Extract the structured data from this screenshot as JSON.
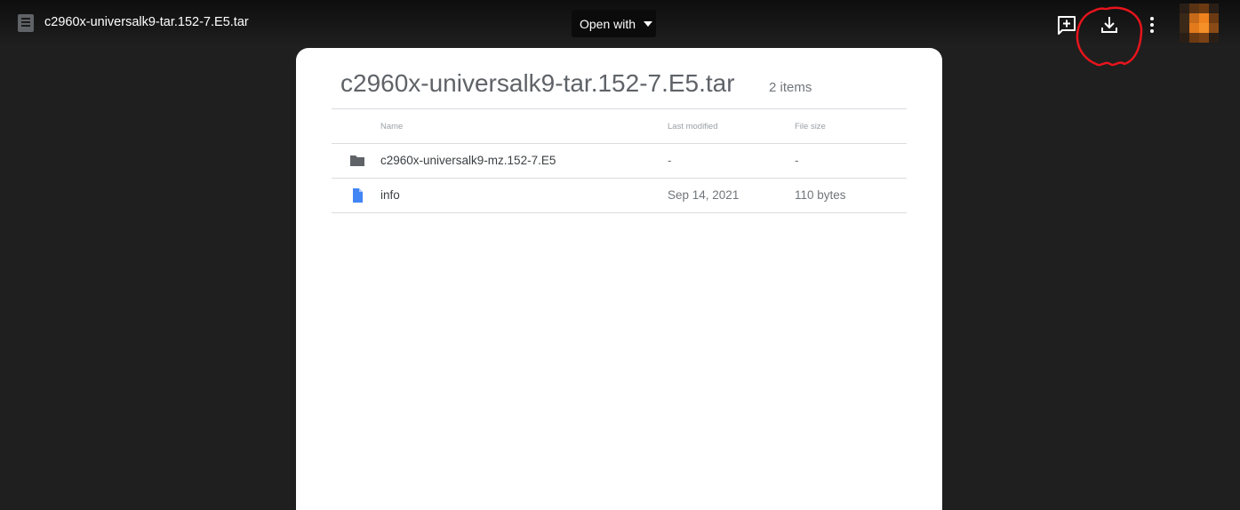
{
  "header": {
    "file_name": "c2960x-universalk9-tar.152-7.E5.tar",
    "open_with_label": "Open with",
    "icons": [
      "drive-file-icon",
      "add-comment-icon",
      "download-icon",
      "more-vert-icon",
      "avatar"
    ],
    "annotation_color": "#e8141c"
  },
  "viewer": {
    "title": "c2960x-universalk9-tar.152-7.E5.tar",
    "item_count": "2 items",
    "columns": {
      "name": "Name",
      "modified": "Last modified",
      "size": "File size"
    },
    "rows": [
      {
        "icon": "folder-icon",
        "name": "c2960x-universalk9-mz.152-7.E5",
        "modified": "-",
        "size": "-"
      },
      {
        "icon": "document-icon",
        "name": "info",
        "modified": "Sep 14, 2021",
        "size": "110 bytes"
      }
    ]
  },
  "colors": {
    "background": "#1f1f1f",
    "topbar": "#121212",
    "card": "#ffffff",
    "folder": "#5f6368",
    "document": "#4285f4",
    "avatar_orange": "#f0821e"
  }
}
